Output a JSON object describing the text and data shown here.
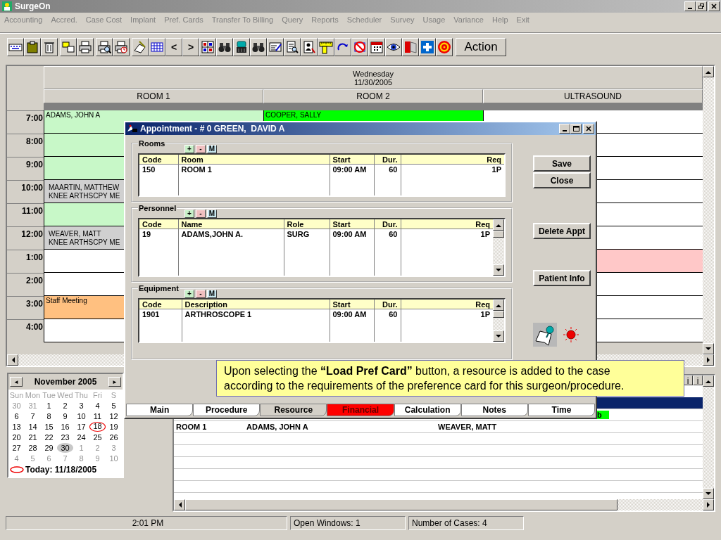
{
  "window": {
    "title": "SurgeOn"
  },
  "menu": [
    {
      "label": "Accounting",
      "disabled": true
    },
    {
      "label": "Accred.",
      "disabled": true
    },
    {
      "label": "Case Cost",
      "disabled": true
    },
    {
      "label": "Implant",
      "disabled": true
    },
    {
      "label": "Pref. Cards",
      "disabled": true
    },
    {
      "label": "Transfer To Billing",
      "disabled": true
    },
    {
      "label": "Query",
      "disabled": true
    },
    {
      "label": "Reports",
      "disabled": true
    },
    {
      "label": "Scheduler",
      "disabled": true
    },
    {
      "label": "Survey",
      "disabled": true
    },
    {
      "label": "Usage",
      "disabled": true
    },
    {
      "label": "Variance",
      "disabled": true
    },
    {
      "label": "Help",
      "disabled": true
    },
    {
      "label": "Exit",
      "disabled": true
    }
  ],
  "toolbar": {
    "previous": "<",
    "next": ">",
    "action": "Action"
  },
  "schedule": {
    "day": "Wednesday",
    "date": "11/30/2005",
    "rooms": [
      "ROOM 1",
      "ROOM 2",
      "ULTRASOUND"
    ],
    "rows": [
      {
        "time": "7:00",
        "cells": [
          {
            "color": "#c8f8c8",
            "lines": [
              "ADAMS, JOHN A"
            ]
          },
          {
            "color": "#00ff00",
            "lines": [
              "COOPER, SALLY"
            ]
          },
          null
        ]
      },
      {
        "time": "8:00",
        "cells": [
          {
            "color": "#c8f8c8"
          },
          null,
          null
        ]
      },
      {
        "time": "9:00",
        "cells": [
          {
            "color": "#c8f8c8"
          },
          null,
          null
        ]
      },
      {
        "time": "10:00",
        "cells": [
          {
            "color": "#d0d0d0",
            "lines": [
              "MAARTIN, MATTHEW",
              "KNEE ARTHSCPY ME"
            ]
          },
          null,
          null
        ]
      },
      {
        "time": "11:00",
        "cells": [
          {
            "color": "#c8f8c8"
          },
          null,
          null
        ]
      },
      {
        "time": "12:00",
        "cells": [
          {
            "color": "#d0d0d0",
            "lines": [
              "WEAVER, MATT",
              "KNEE ARTHSCPY ME"
            ]
          },
          null,
          null
        ]
      },
      {
        "time": "1:00",
        "cells": [
          null,
          null,
          {
            "color": "#ffc8c8"
          }
        ]
      },
      {
        "time": "2:00",
        "cells": [
          null,
          null,
          null
        ]
      },
      {
        "time": "3:00",
        "cells": [
          {
            "color": "#ffc080",
            "lines": [
              "Staff Meeting"
            ]
          },
          null,
          null
        ]
      },
      {
        "time": "4:00",
        "cells": [
          null,
          null,
          null
        ]
      }
    ]
  },
  "calendar": {
    "month": "November 2005",
    "previous": "◄",
    "next": "►",
    "weekdays": [
      "Sun",
      "Mon",
      "Tue",
      "Wed",
      "Thu",
      "Fri",
      "S"
    ],
    "weeks": [
      [
        {
          "d": "30",
          "other": true,
          "selected": false,
          "today": false
        },
        {
          "d": "31",
          "other": true,
          "selected": false,
          "today": false
        },
        {
          "d": "1",
          "other": false,
          "selected": false,
          "today": false
        },
        {
          "d": "2",
          "other": false,
          "selected": false,
          "today": false
        },
        {
          "d": "3",
          "other": false,
          "selected": false,
          "today": false
        },
        {
          "d": "4",
          "other": false,
          "selected": false,
          "today": false
        },
        {
          "d": "5",
          "other": false,
          "selected": false,
          "today": false
        }
      ],
      [
        {
          "d": "6",
          "other": false,
          "selected": false,
          "today": false
        },
        {
          "d": "7",
          "other": false,
          "selected": false,
          "today": false
        },
        {
          "d": "8",
          "other": false,
          "selected": false,
          "today": false
        },
        {
          "d": "9",
          "other": false,
          "selected": false,
          "today": false
        },
        {
          "d": "10",
          "other": false,
          "selected": false,
          "today": false
        },
        {
          "d": "11",
          "other": false,
          "selected": false,
          "today": false
        },
        {
          "d": "12",
          "other": false,
          "selected": false,
          "today": false
        }
      ],
      [
        {
          "d": "13",
          "other": false,
          "selected": false,
          "today": false
        },
        {
          "d": "14",
          "other": false,
          "selected": false,
          "today": false
        },
        {
          "d": "15",
          "other": false,
          "selected": false,
          "today": false
        },
        {
          "d": "16",
          "other": false,
          "selected": false,
          "today": false
        },
        {
          "d": "17",
          "other": false,
          "selected": false,
          "today": false
        },
        {
          "d": "18",
          "other": false,
          "selected": false,
          "today": true
        },
        {
          "d": "19",
          "other": false,
          "selected": false,
          "today": false
        }
      ],
      [
        {
          "d": "20",
          "other": false,
          "selected": false,
          "today": false
        },
        {
          "d": "21",
          "other": false,
          "selected": false,
          "today": false
        },
        {
          "d": "22",
          "other": false,
          "selected": false,
          "today": false
        },
        {
          "d": "23",
          "other": false,
          "selected": false,
          "today": false
        },
        {
          "d": "24",
          "other": false,
          "selected": false,
          "today": false
        },
        {
          "d": "25",
          "other": false,
          "selected": false,
          "today": false
        },
        {
          "d": "26",
          "other": false,
          "selected": false,
          "today": false
        }
      ],
      [
        {
          "d": "27",
          "other": false,
          "selected": false,
          "today": false
        },
        {
          "d": "28",
          "other": false,
          "selected": false,
          "today": false
        },
        {
          "d": "29",
          "other": false,
          "selected": false,
          "today": false
        },
        {
          "d": "30",
          "other": false,
          "selected": true,
          "today": false
        },
        {
          "d": "1",
          "other": true,
          "selected": false,
          "today": false
        },
        {
          "d": "2",
          "other": true,
          "selected": false,
          "today": false
        },
        {
          "d": "3",
          "other": true,
          "selected": false,
          "today": false
        }
      ],
      [
        {
          "d": "4",
          "other": true,
          "selected": false,
          "today": false
        },
        {
          "d": "5",
          "other": true,
          "selected": false,
          "today": false
        },
        {
          "d": "6",
          "other": true,
          "selected": false,
          "today": false
        },
        {
          "d": "7",
          "other": true,
          "selected": false,
          "today": false
        },
        {
          "d": "8",
          "other": true,
          "selected": false,
          "today": false
        },
        {
          "d": "9",
          "other": true,
          "selected": false,
          "today": false
        },
        {
          "d": "10",
          "other": true,
          "selected": false,
          "today": false
        }
      ]
    ],
    "today_label": "Today: 11/18/2005"
  },
  "case_list": {
    "headers": [
      "i",
      "i"
    ],
    "rows": [
      {
        "selected": true
      },
      {
        "selected": false,
        "flag": "b"
      },
      {
        "selected": false,
        "cells": [
          "ROOM 1",
          "ADAMS, JOHN A",
          "WEAVER, MATT"
        ]
      }
    ]
  },
  "status_bar": [
    "2:01 PM",
    "Open Windows: 1",
    "Number of Cases: 4"
  ],
  "dialog": {
    "title": "Appointment - # 0 GREEN,  DAVID A",
    "groups": [
      {
        "title": "Rooms",
        "buttons": [
          "+",
          "-",
          "M"
        ],
        "columns": [
          "Code",
          "Room",
          "Start",
          "Dur.",
          "Req"
        ],
        "rows": [
          [
            "150",
            "ROOM 1",
            "09:00 AM",
            "60",
            "1P"
          ]
        ]
      },
      {
        "title": "Personnel",
        "buttons": [
          "+",
          "-",
          "M"
        ],
        "columns": [
          "Code",
          "Name",
          "Role",
          "Start",
          "Dur.",
          "Req"
        ],
        "rows": [
          [
            "19",
            "ADAMS,JOHN A.",
            "SURG",
            "09:00 AM",
            "60",
            "1P"
          ]
        ]
      },
      {
        "title": "Equipment",
        "buttons": [
          "+",
          "-",
          "M"
        ],
        "columns": [
          "Code",
          "Description",
          "Start",
          "Dur.",
          "Req"
        ],
        "rows": [
          [
            "1901",
            "ARTHROSCOPE 1",
            "09:00 AM",
            "60",
            "1P"
          ]
        ]
      }
    ],
    "buttons": [
      "Save",
      "Close",
      "Delete Appt",
      "Patient Info"
    ],
    "tabs": [
      {
        "label": "Main",
        "selected": false
      },
      {
        "label": "Procedure",
        "selected": false
      },
      {
        "label": "Resource",
        "selected": true
      },
      {
        "label": "Financial",
        "selected": false,
        "color": "#ff0000"
      },
      {
        "label": "Calculation",
        "selected": false
      },
      {
        "label": "Notes",
        "selected": false
      },
      {
        "label": "Time",
        "selected": false
      }
    ]
  },
  "callout": {
    "text": "Upon selecting the **“Load Pref Card”** button, a resource is added to the case according to the requirements of the preference card for this surgeon/procedure."
  }
}
